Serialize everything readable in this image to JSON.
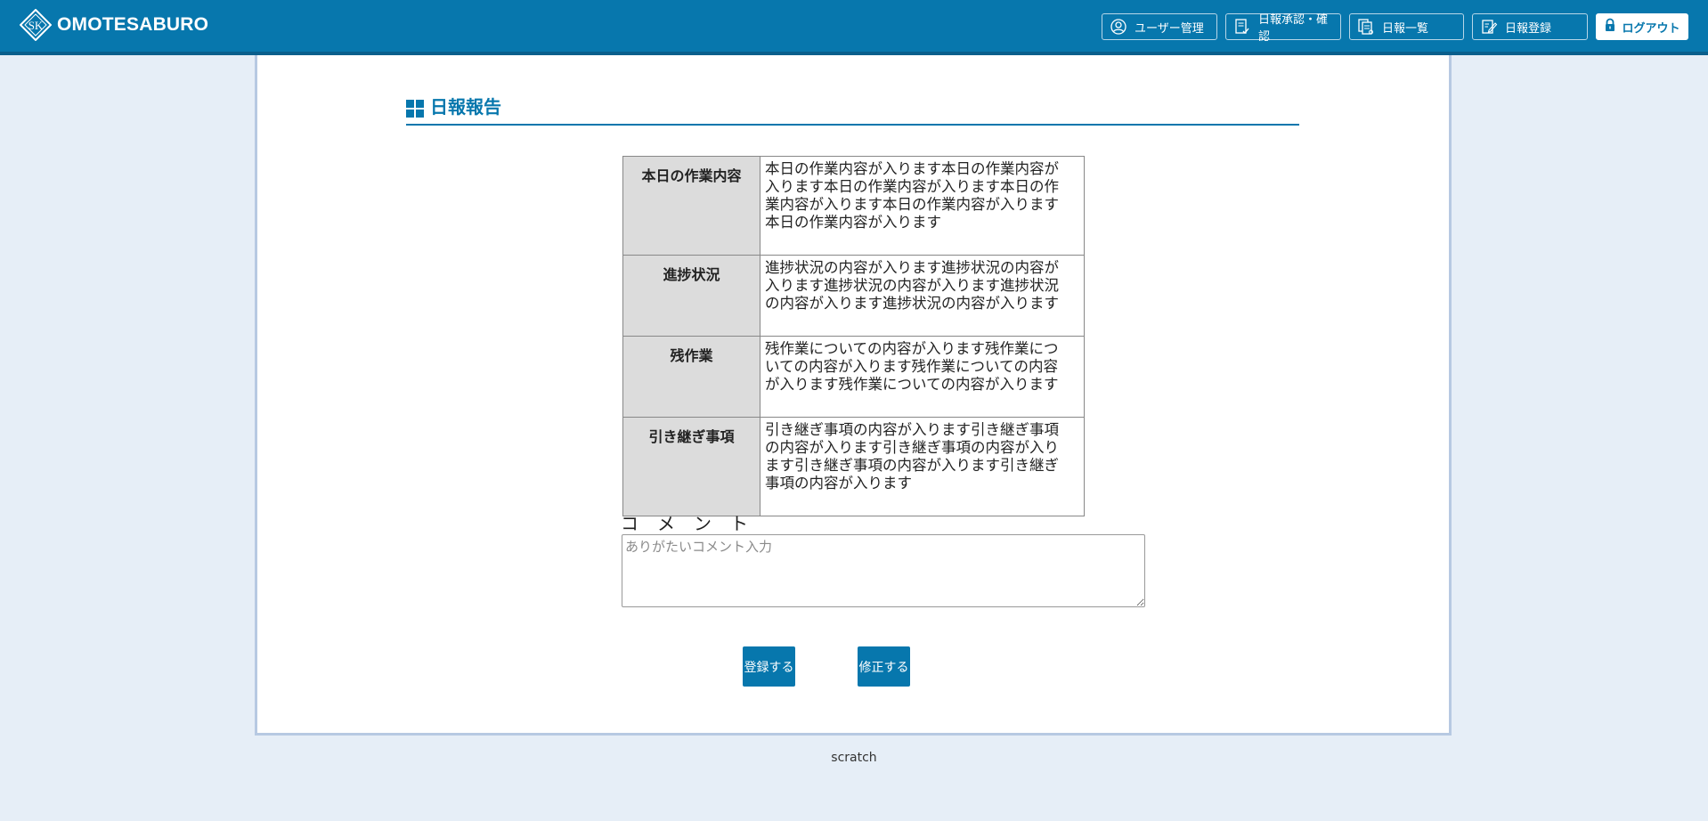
{
  "header": {
    "brand": "OMOTESABURO",
    "logo_text": "SK",
    "nav": [
      {
        "label": "ユーザー管理",
        "icon": "user-circle-icon"
      },
      {
        "label": "日報承認・確認",
        "icon": "document-check-icon"
      },
      {
        "label": "日報一覧",
        "icon": "documents-list-icon"
      },
      {
        "label": "日報登録",
        "icon": "edit-document-icon"
      },
      {
        "label": "ログアウト",
        "icon": "lock-icon"
      }
    ]
  },
  "page": {
    "title": "日報報告"
  },
  "report": [
    {
      "label": "本日の作業内容",
      "value": "本日の作業内容が入ります本日の作業内容が入ります本日の作業内容が入ります本日の作業内容が入ります本日の作業内容が入ります本日の作業内容が入ります"
    },
    {
      "label": "進捗状況",
      "value": "進捗状況の内容が入ります進捗状況の内容が入ります進捗状況の内容が入ります進捗状況の内容が入ります進捗状況の内容が入ります"
    },
    {
      "label": "残作業",
      "value": "残作業についての内容が入ります残作業についての内容が入ります残作業についての内容が入ります残作業についての内容が入ります"
    },
    {
      "label": "引き継ぎ事項",
      "value": "引き継ぎ事項の内容が入ります引き継ぎ事項の内容が入ります引き継ぎ事項の内容が入ります引き継ぎ事項の内容が入ります引き継ぎ事項の内容が入ります"
    }
  ],
  "comment": {
    "label": "コメント",
    "placeholder": "ありがたいコメント入力",
    "value": ""
  },
  "actions": {
    "register_label": "登録する",
    "edit_label": "修正する"
  },
  "footer": {
    "text": "scratch"
  },
  "colors": {
    "primary": "#0777ad",
    "background": "#e6eef7",
    "table_header_bg": "#dcdcdc"
  }
}
